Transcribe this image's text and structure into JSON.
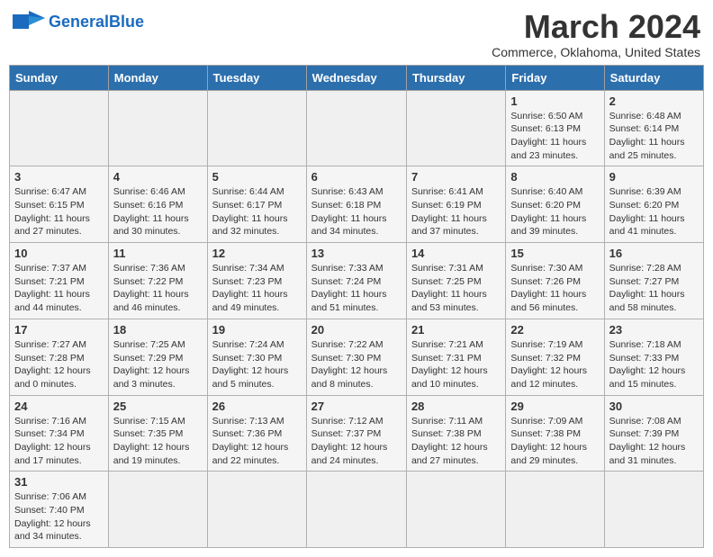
{
  "header": {
    "logo_general": "General",
    "logo_blue": "Blue",
    "month_title": "March 2024",
    "subtitle": "Commerce, Oklahoma, United States"
  },
  "weekdays": [
    "Sunday",
    "Monday",
    "Tuesday",
    "Wednesday",
    "Thursday",
    "Friday",
    "Saturday"
  ],
  "weeks": [
    [
      {
        "day": "",
        "info": ""
      },
      {
        "day": "",
        "info": ""
      },
      {
        "day": "",
        "info": ""
      },
      {
        "day": "",
        "info": ""
      },
      {
        "day": "",
        "info": ""
      },
      {
        "day": "1",
        "info": "Sunrise: 6:50 AM\nSunset: 6:13 PM\nDaylight: 11 hours\nand 23 minutes."
      },
      {
        "day": "2",
        "info": "Sunrise: 6:48 AM\nSunset: 6:14 PM\nDaylight: 11 hours\nand 25 minutes."
      }
    ],
    [
      {
        "day": "3",
        "info": "Sunrise: 6:47 AM\nSunset: 6:15 PM\nDaylight: 11 hours\nand 27 minutes."
      },
      {
        "day": "4",
        "info": "Sunrise: 6:46 AM\nSunset: 6:16 PM\nDaylight: 11 hours\nand 30 minutes."
      },
      {
        "day": "5",
        "info": "Sunrise: 6:44 AM\nSunset: 6:17 PM\nDaylight: 11 hours\nand 32 minutes."
      },
      {
        "day": "6",
        "info": "Sunrise: 6:43 AM\nSunset: 6:18 PM\nDaylight: 11 hours\nand 34 minutes."
      },
      {
        "day": "7",
        "info": "Sunrise: 6:41 AM\nSunset: 6:19 PM\nDaylight: 11 hours\nand 37 minutes."
      },
      {
        "day": "8",
        "info": "Sunrise: 6:40 AM\nSunset: 6:20 PM\nDaylight: 11 hours\nand 39 minutes."
      },
      {
        "day": "9",
        "info": "Sunrise: 6:39 AM\nSunset: 6:20 PM\nDaylight: 11 hours\nand 41 minutes."
      }
    ],
    [
      {
        "day": "10",
        "info": "Sunrise: 7:37 AM\nSunset: 7:21 PM\nDaylight: 11 hours\nand 44 minutes."
      },
      {
        "day": "11",
        "info": "Sunrise: 7:36 AM\nSunset: 7:22 PM\nDaylight: 11 hours\nand 46 minutes."
      },
      {
        "day": "12",
        "info": "Sunrise: 7:34 AM\nSunset: 7:23 PM\nDaylight: 11 hours\nand 49 minutes."
      },
      {
        "day": "13",
        "info": "Sunrise: 7:33 AM\nSunset: 7:24 PM\nDaylight: 11 hours\nand 51 minutes."
      },
      {
        "day": "14",
        "info": "Sunrise: 7:31 AM\nSunset: 7:25 PM\nDaylight: 11 hours\nand 53 minutes."
      },
      {
        "day": "15",
        "info": "Sunrise: 7:30 AM\nSunset: 7:26 PM\nDaylight: 11 hours\nand 56 minutes."
      },
      {
        "day": "16",
        "info": "Sunrise: 7:28 AM\nSunset: 7:27 PM\nDaylight: 11 hours\nand 58 minutes."
      }
    ],
    [
      {
        "day": "17",
        "info": "Sunrise: 7:27 AM\nSunset: 7:28 PM\nDaylight: 12 hours\nand 0 minutes."
      },
      {
        "day": "18",
        "info": "Sunrise: 7:25 AM\nSunset: 7:29 PM\nDaylight: 12 hours\nand 3 minutes."
      },
      {
        "day": "19",
        "info": "Sunrise: 7:24 AM\nSunset: 7:30 PM\nDaylight: 12 hours\nand 5 minutes."
      },
      {
        "day": "20",
        "info": "Sunrise: 7:22 AM\nSunset: 7:30 PM\nDaylight: 12 hours\nand 8 minutes."
      },
      {
        "day": "21",
        "info": "Sunrise: 7:21 AM\nSunset: 7:31 PM\nDaylight: 12 hours\nand 10 minutes."
      },
      {
        "day": "22",
        "info": "Sunrise: 7:19 AM\nSunset: 7:32 PM\nDaylight: 12 hours\nand 12 minutes."
      },
      {
        "day": "23",
        "info": "Sunrise: 7:18 AM\nSunset: 7:33 PM\nDaylight: 12 hours\nand 15 minutes."
      }
    ],
    [
      {
        "day": "24",
        "info": "Sunrise: 7:16 AM\nSunset: 7:34 PM\nDaylight: 12 hours\nand 17 minutes."
      },
      {
        "day": "25",
        "info": "Sunrise: 7:15 AM\nSunset: 7:35 PM\nDaylight: 12 hours\nand 19 minutes."
      },
      {
        "day": "26",
        "info": "Sunrise: 7:13 AM\nSunset: 7:36 PM\nDaylight: 12 hours\nand 22 minutes."
      },
      {
        "day": "27",
        "info": "Sunrise: 7:12 AM\nSunset: 7:37 PM\nDaylight: 12 hours\nand 24 minutes."
      },
      {
        "day": "28",
        "info": "Sunrise: 7:11 AM\nSunset: 7:38 PM\nDaylight: 12 hours\nand 27 minutes."
      },
      {
        "day": "29",
        "info": "Sunrise: 7:09 AM\nSunset: 7:38 PM\nDaylight: 12 hours\nand 29 minutes."
      },
      {
        "day": "30",
        "info": "Sunrise: 7:08 AM\nSunset: 7:39 PM\nDaylight: 12 hours\nand 31 minutes."
      }
    ],
    [
      {
        "day": "31",
        "info": "Sunrise: 7:06 AM\nSunset: 7:40 PM\nDaylight: 12 hours\nand 34 minutes."
      },
      {
        "day": "",
        "info": ""
      },
      {
        "day": "",
        "info": ""
      },
      {
        "day": "",
        "info": ""
      },
      {
        "day": "",
        "info": ""
      },
      {
        "day": "",
        "info": ""
      },
      {
        "day": "",
        "info": ""
      }
    ]
  ]
}
